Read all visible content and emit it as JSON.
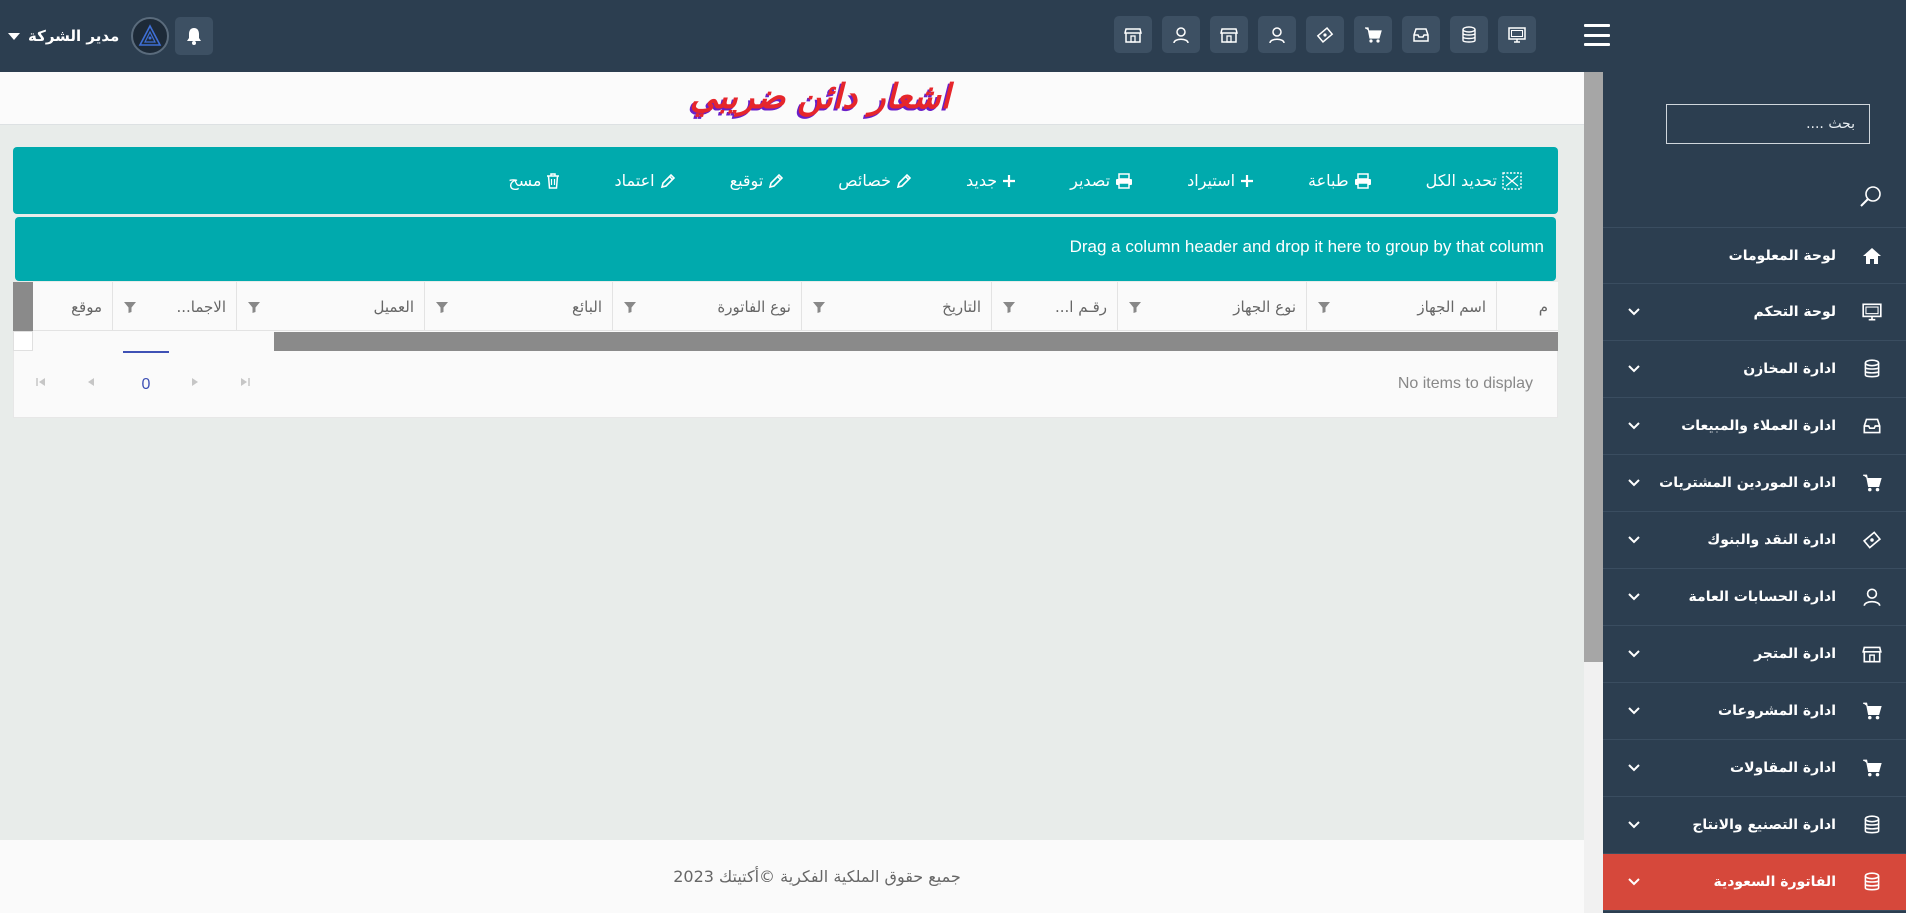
{
  "topbar": {
    "user_name": "مدير الشركة",
    "icons": [
      "store-icon",
      "user-icon",
      "store-icon",
      "user-icon",
      "ticket-icon",
      "cart-icon",
      "inbox-icon",
      "database-icon",
      "monitor-icon"
    ]
  },
  "sidebar": {
    "search_placeholder": "بحث ....",
    "items": [
      {
        "label": "لوحة المعلومات",
        "icon": "home-icon",
        "has_submenu": false
      },
      {
        "label": "لوحة التحكم",
        "icon": "monitor-icon",
        "has_submenu": true
      },
      {
        "label": "ادارة المخازن",
        "icon": "database-icon",
        "has_submenu": true
      },
      {
        "label": "ادارة العملاء والمبيعات",
        "icon": "inbox-icon",
        "has_submenu": true
      },
      {
        "label": "ادارة الموردين المشتريات",
        "icon": "cart-icon",
        "has_submenu": true
      },
      {
        "label": "ادارة النقد والبنوك",
        "icon": "ticket-icon",
        "has_submenu": true
      },
      {
        "label": "ادارة الحسابات العامة",
        "icon": "user-icon",
        "has_submenu": true
      },
      {
        "label": "ادارة المتجر",
        "icon": "store-icon",
        "has_submenu": true
      },
      {
        "label": "ادارة المشروعات",
        "icon": "cart-icon",
        "has_submenu": true
      },
      {
        "label": "ادارة المقاولات",
        "icon": "cart-icon",
        "has_submenu": true
      },
      {
        "label": "ادارة التصنيع والانتاج",
        "icon": "database-icon",
        "has_submenu": true
      },
      {
        "label": "الفاتورة السعودية",
        "icon": "database-icon",
        "has_submenu": true,
        "active": true
      }
    ]
  },
  "page": {
    "title": "اشعار دائن ضريبي"
  },
  "toolbar": {
    "select_all": "تحديد الكل",
    "print": "طباعة",
    "import": "استيراد",
    "export": "تصدير",
    "new": "جديد",
    "properties": "خصائص",
    "sign": "توقيع",
    "approve": "اعتماد",
    "delete": "مسح"
  },
  "grid": {
    "group_hint": "Drag a column header and drop it here to group by that column",
    "columns": [
      {
        "label": "م",
        "width": 62,
        "filter": false
      },
      {
        "label": "اسم الجهاز",
        "width": 190,
        "filter": true
      },
      {
        "label": "نوع الجهاز",
        "width": 189,
        "filter": true
      },
      {
        "label": "رقـم ا...",
        "width": 126,
        "filter": true
      },
      {
        "label": "التاريخ",
        "width": 190,
        "filter": true
      },
      {
        "label": "نوع الفاتورة",
        "width": 189,
        "filter": true
      },
      {
        "label": "البائع",
        "width": 188,
        "filter": true
      },
      {
        "label": "العميل",
        "width": 188,
        "filter": true
      },
      {
        "label": "الاجما...",
        "width": 124,
        "filter": true
      },
      {
        "label": "موقع",
        "width": 99,
        "filter": false
      }
    ],
    "pager": {
      "page": "0",
      "info": "No items to display"
    }
  },
  "footer": {
    "copyright": "جميع حقوق الملكية الفكرية ©أكتيتك 2023"
  },
  "colors": {
    "topbar": "#2c3e50",
    "accent": "#00aaad",
    "active": "#d6483b",
    "pager": "#3f51b5"
  }
}
